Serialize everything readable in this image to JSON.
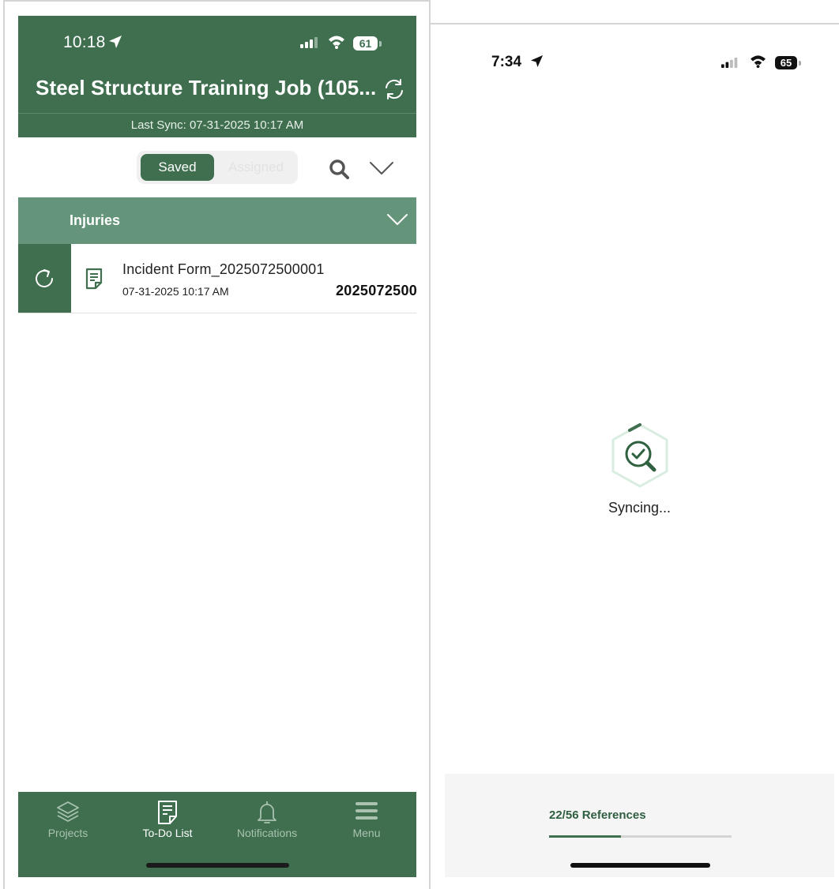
{
  "left_screen": {
    "status_bar": {
      "time": "10:18",
      "battery": "61"
    },
    "header": {
      "title": "Steel Structure Training Job (105...",
      "last_sync": "Last Sync: 07-31-2025 10:17 AM"
    },
    "segments": {
      "saved": "Saved",
      "assigned": "Assigned",
      "selected": "Saved"
    },
    "group": {
      "label": "Injuries"
    },
    "items": [
      {
        "title": "Incident Form_2025072500001",
        "date": "07-31-2025 10:17 AM",
        "id": "2025072500"
      }
    ],
    "tabbar": [
      {
        "label": "Projects",
        "icon": "layers-icon",
        "active": false
      },
      {
        "label": "To-Do List",
        "icon": "document-icon",
        "active": true
      },
      {
        "label": "Notifications",
        "icon": "bell-icon",
        "active": false
      },
      {
        "label": "Menu",
        "icon": "hamburger-menu-icon",
        "active": false
      }
    ]
  },
  "right_screen": {
    "status_bar": {
      "time": "7:34",
      "battery": "65"
    },
    "syncing_label": "Syncing...",
    "progress": {
      "label": "22/56 References",
      "current": 22,
      "total": 56
    }
  },
  "colors": {
    "brand_green": "#3f6f4f",
    "group_green": "#64957a"
  }
}
